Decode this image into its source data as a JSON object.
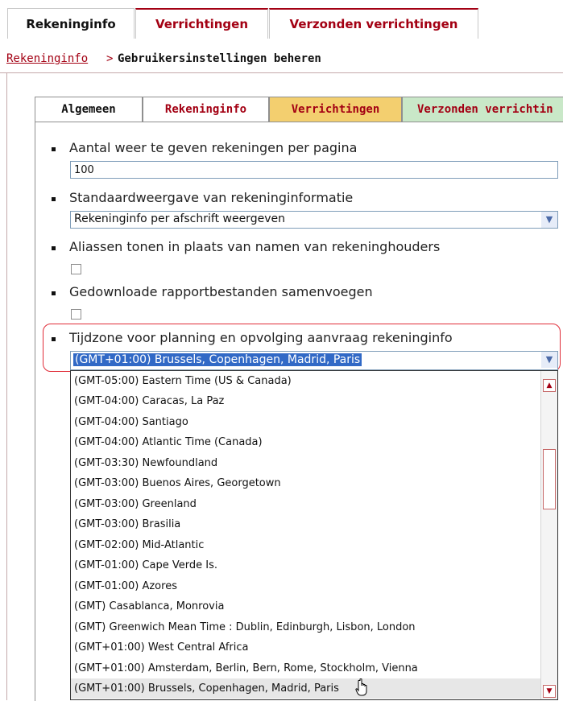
{
  "top_tabs": [
    "Rekeninginfo",
    "Verrichtingen",
    "Verzonden verrichtingen"
  ],
  "breadcrumb": {
    "link": "Rekeninginfo",
    "separator": ">",
    "current": "Gebruikersinstellingen beheren"
  },
  "inner_tabs": [
    "Algemeen",
    "Rekeninginfo",
    "Verrichtingen",
    "Verzonden verrichtin"
  ],
  "settings": {
    "rows_per_page_label": "Aantal weer te geven rekeningen per pagina",
    "rows_per_page_value": "100",
    "default_view_label": "Standaardweergave van rekeninginformatie",
    "default_view_value": "Rekeninginfo per afschrift weergeven",
    "aliases_label": "Aliassen tonen in plaats van namen van rekeninghouders",
    "aliases_checked": false,
    "merge_reports_label": "Gedownloade rapportbestanden samenvoegen",
    "merge_reports_checked": false,
    "timezone_label": "Tijdzone voor planning en opvolging aanvraag rekeninginfo",
    "timezone_value": "(GMT+01:00) Brussels, Copenhagen, Madrid, Paris"
  },
  "timezone_options": [
    "(GMT-05:00) Eastern Time (US & Canada)",
    "(GMT-04:00) Caracas, La Paz",
    "(GMT-04:00) Santiago",
    "(GMT-04:00) Atlantic Time (Canada)",
    "(GMT-03:30) Newfoundland",
    "(GMT-03:00) Buenos Aires, Georgetown",
    "(GMT-03:00) Greenland",
    "(GMT-03:00) Brasilia",
    "(GMT-02:00) Mid-Atlantic",
    "(GMT-01:00) Cape Verde Is.",
    "(GMT-01:00) Azores",
    "(GMT) Casablanca, Monrovia",
    "(GMT) Greenwich Mean Time : Dublin, Edinburgh, Lisbon, London",
    "(GMT+01:00) West Central Africa",
    "(GMT+01:00) Amsterdam, Berlin, Bern, Rome, Stockholm, Vienna",
    "(GMT+01:00) Brussels, Copenhagen, Madrid, Paris"
  ],
  "icons": {
    "dropdown": "chevron-down-icon",
    "scroll_up": "scroll-up-icon",
    "scroll_down": "scroll-down-icon",
    "cursor": "hand-pointer-icon"
  },
  "colors": {
    "brand_red": "#a30013",
    "selection_blue": "#3169c6",
    "verrichtingen_tab": "#f3cf6f",
    "verzonden_tab": "#c9e8c8",
    "highlight_ring": "#e02c38"
  }
}
